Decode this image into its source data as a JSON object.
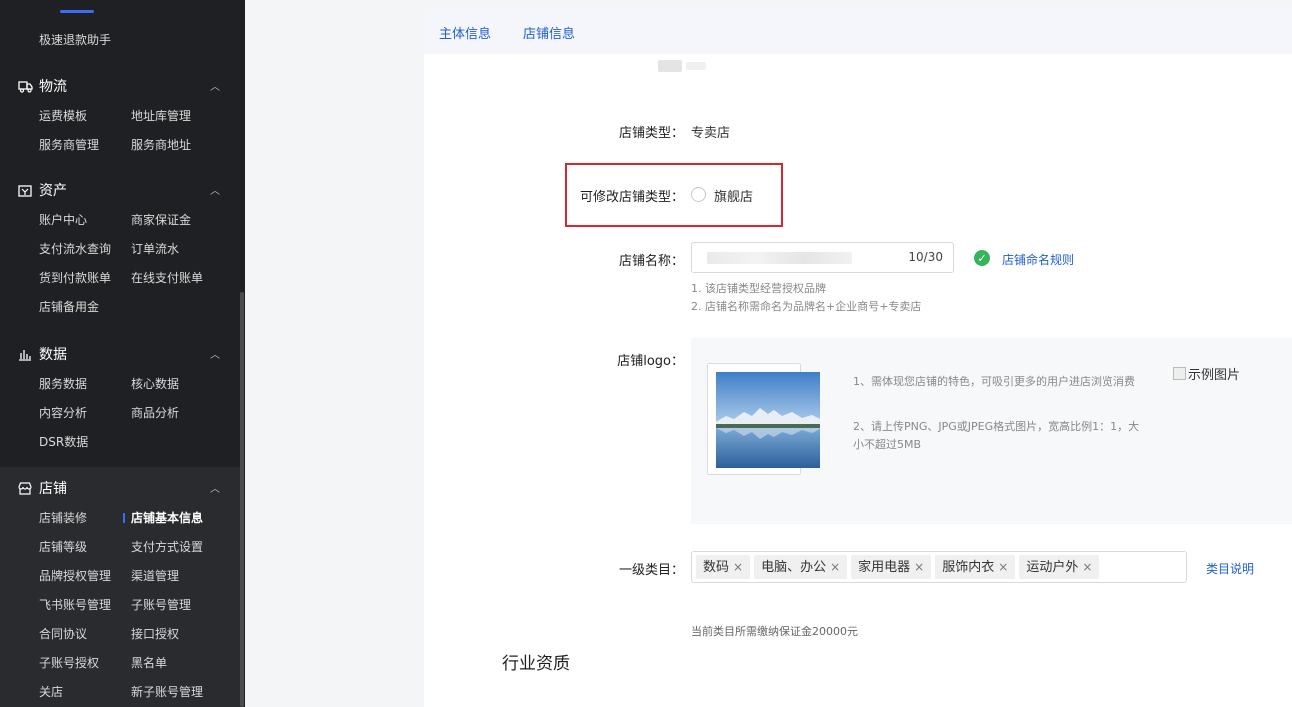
{
  "sidebar": {
    "top_item": "极速退款助手",
    "sections": [
      {
        "title": "物流",
        "icon": "truck-icon",
        "items": [
          "运费模板",
          "地址库管理",
          "服务商管理",
          "服务商地址"
        ]
      },
      {
        "title": "资产",
        "icon": "wallet-icon",
        "items": [
          "账户中心",
          "商家保证金",
          "支付流水查询",
          "订单流水",
          "货到付款账单",
          "在线支付账单",
          "店铺备用金"
        ]
      },
      {
        "title": "数据",
        "icon": "bar-chart-icon",
        "items": [
          "服务数据",
          "核心数据",
          "内容分析",
          "商品分析",
          "DSR数据"
        ]
      },
      {
        "title": "店铺",
        "icon": "store-icon",
        "items": [
          "店铺装修",
          "店铺基本信息",
          "店铺等级",
          "支付方式设置",
          "品牌授权管理",
          "渠道管理",
          "飞书账号管理",
          "子账号管理",
          "合同协议",
          "接口授权",
          "子账号授权",
          "黑名单",
          "关店",
          "新子账号管理"
        ],
        "active": "店铺基本信息"
      }
    ]
  },
  "tabs": [
    "主体信息",
    "店铺信息"
  ],
  "form": {
    "store_type_label": "店铺类型：",
    "store_type_value": "专卖店",
    "changeable_type_label": "可修改店铺类型：",
    "changeable_type_option": "旗舰店",
    "store_name_label": "店铺名称：",
    "store_name_counter": "10/30",
    "naming_rules_link": "店铺命名规则",
    "name_hint_1": "1. 该店铺类型经营授权品牌",
    "name_hint_2": "2. 店铺名称需命名为品牌名+企业商号+专卖店",
    "logo_label": "店铺logo：",
    "logo_hint_1": "1、需体现您店铺的特色，可吸引更多的用户进店浏览消费",
    "logo_hint_2": "2、请上传PNG、JPG或JPEG格式图片，宽高比例1：1，大小不超过5MB",
    "sample_image_alt": "示例图片",
    "category_label": "一级类目：",
    "categories": [
      "数码",
      "电脑、办公",
      "家用电器",
      "服饰内衣",
      "运动户外"
    ],
    "category_link": "类目说明",
    "deposit_hint": "当前类目所需缴纳保证金20000元",
    "industry_title": "行业资质"
  }
}
